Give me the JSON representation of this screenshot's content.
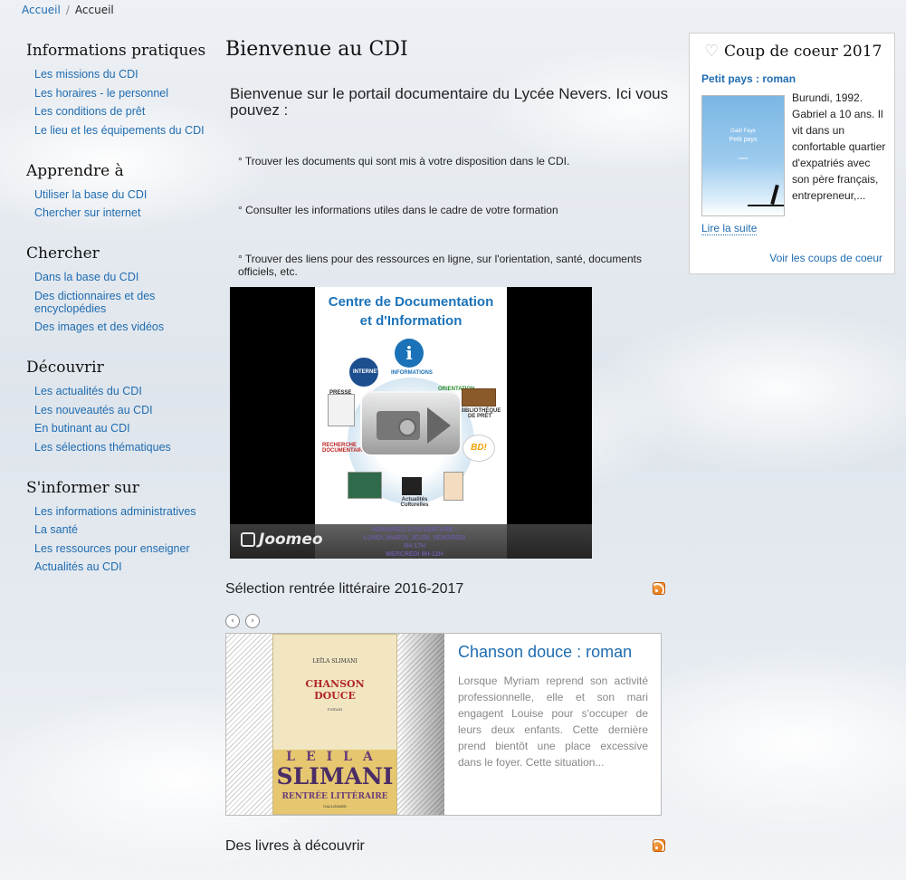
{
  "breadcrumb": {
    "home": "Accueil",
    "separator": "/",
    "current": "Accueil"
  },
  "sidebar": {
    "sections": [
      {
        "title": "Informations pratiques",
        "items": [
          "Les missions du CDI",
          "Les horaires - le personnel",
          "Les conditions de prêt",
          "Le lieu et les équipements du CDI"
        ]
      },
      {
        "title": "Apprendre à",
        "items": [
          "Utiliser la base du CDI",
          "Chercher sur internet"
        ]
      },
      {
        "title": "Chercher",
        "items": [
          "Dans la base du CDI",
          "Des dictionnaires et des encyclopédies",
          "Des images et des vidéos"
        ]
      },
      {
        "title": "Découvrir",
        "items": [
          "Les actualités du CDI",
          "Les nouveautés au CDI",
          "En butinant au CDI",
          "Les sélections thématiques"
        ]
      },
      {
        "title": "S'informer sur",
        "items": [
          "Les informations administratives",
          "La santé",
          "Les ressources pour enseigner",
          "Actualités au CDI"
        ]
      }
    ]
  },
  "main": {
    "title": "Bienvenue au CDI",
    "intro": "Bienvenue sur le portail documentaire du Lycée Nevers. Ici vous pouvez :",
    "bullets": [
      "° Trouver les documents qui sont mis à votre disposition dans le CDI.",
      "°  Consulter les informations utiles dans le cadre de votre formation",
      "° Trouver des liens pour des ressources en ligne, sur l'orientation, santé, documents officiels, etc."
    ],
    "video": {
      "poster_title_line1": "Centre de Documentation",
      "poster_title_line2": "et d'Information",
      "info_glyph": "i",
      "labels": {
        "internet": "INTERNET",
        "informations": "INFORMATIONS",
        "orientation": "ORIENTATION",
        "presse": "PRESSE",
        "bibliotheque": "BIBLIOTHÈQUE DE PRÊT",
        "recherche": "RECHERCHE DOCUMENTAIRE",
        "bd": "BD!",
        "actualites": "Actualités Culturelles"
      },
      "hours_title": "HORAIRES D'OUVERTURE :",
      "hours_line1": "LUNDI, MARDI, JEUDI, VENDREDI 8H-17H",
      "hours_line2": "MERCREDI 8H-12H",
      "brand": "Joomeo"
    },
    "selection": {
      "title": "Sélection rentrée littéraire 2016-2017",
      "nav_prev": "‹",
      "nav_next": "›",
      "book": {
        "title": "Chanson douce : roman",
        "summary": "Lorsque Myriam reprend son activité professionnelle, elle et son mari engagent Louise pour s'occuper de leurs deux enfants. Cette dernière prend bientôt une place excessive dans le foyer. Cette situation...",
        "cover_author": "LEÏLA SLIMANI",
        "cover_title_line1": "CHANSON",
        "cover_title_line2": "DOUCE",
        "cover_sub": "roman",
        "band_first": "LEILA",
        "band_last": "SLIMANI",
        "band_rentree": "RENTRÉE LITTÉRAIRE",
        "band_publisher": "GALLIMARD"
      }
    },
    "discover": {
      "title": "Des livres à découvrir"
    }
  },
  "widget": {
    "title": "Coup de coeur 2017",
    "heart_glyph": "♡",
    "book_title": "Petit pays : roman",
    "cover_author": "Gaël Faye",
    "cover_title": "Petit pays",
    "cover_sub": "roman",
    "text": "Burundi, 1992. Gabriel a 10 ans. Il vit dans un confortable quartier d'expatriés avec son père français, entrepreneur,...",
    "read_more": "Lire la suite",
    "see_all": "Voir les coups de coeur"
  },
  "colors": {
    "link": "#1f6cb0",
    "heading": "#111111",
    "summary_text": "#888888",
    "rss_orange": "#e46c0a"
  }
}
